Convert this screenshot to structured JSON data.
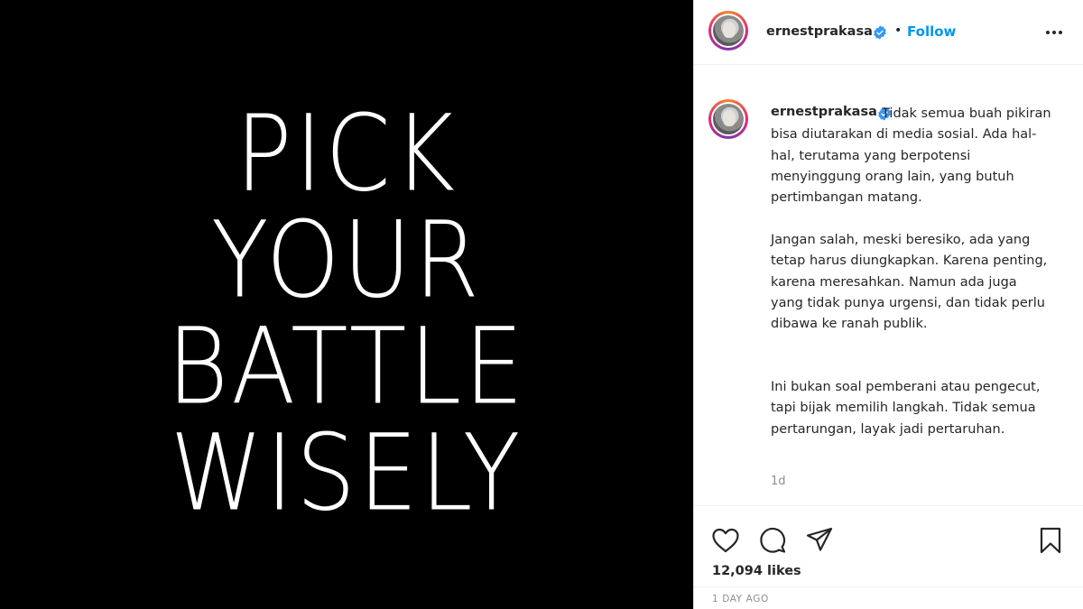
{
  "post_image": {
    "lines": [
      "PICK",
      "YOUR",
      "BATTLE",
      "WISELY"
    ]
  },
  "header": {
    "username": "ernestprakasa",
    "separator": "•",
    "follow_label": "Follow",
    "more_icon": "more-horizontal-icon",
    "verified_color": "#3897f0"
  },
  "caption": {
    "username": "ernestprakasa",
    "paragraphs": [
      "Tidak semua buah pikiran bisa diutarakan di media sosial. Ada hal-hal, terutama yang berpotensi menyinggung orang lain, yang butuh pertimbangan matang.",
      "Jangan salah, meski beresiko, ada yang tetap harus diungkapkan. Karena penting, karena meresahkan. Namun ada juga yang tidak punya urgensi, dan tidak perlu dibawa ke ranah publik.",
      "Ini bukan soal pemberani atau pengecut, tapi bijak memilih langkah. Tidak semua pertarungan, layak jadi pertaruhan."
    ],
    "age": "1d"
  },
  "actions": {
    "like_icon": "heart-icon",
    "comment_icon": "comment-icon",
    "share_icon": "paper-plane-icon",
    "save_icon": "bookmark-icon"
  },
  "stats": {
    "likes": "12,094 likes",
    "date": "1 DAY AGO"
  },
  "colors": {
    "accent": "#0095f6",
    "text": "#262626",
    "muted": "#8e8e8e"
  }
}
